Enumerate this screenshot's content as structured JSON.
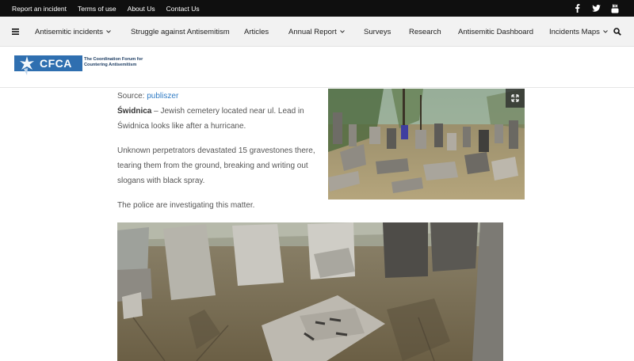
{
  "topbar": {
    "links": [
      "Report an incident",
      "Terms of use",
      "About Us",
      "Contact Us"
    ],
    "social_icons": [
      "facebook-icon",
      "twitter-icon",
      "youtube-icon"
    ]
  },
  "nav": {
    "items": [
      {
        "label": "Antisemitic incidents",
        "dropdown": true
      },
      {
        "label": "Struggle against Antisemitism",
        "dropdown": false
      },
      {
        "label": "Articles",
        "dropdown": false
      },
      {
        "label": "Annual Report",
        "dropdown": true
      },
      {
        "label": "Surveys",
        "dropdown": false
      },
      {
        "label": "Research",
        "dropdown": false
      },
      {
        "label": "Antisemitic Dashboard",
        "dropdown": false
      },
      {
        "label": "Incidents Maps",
        "dropdown": true
      }
    ]
  },
  "logo": {
    "name": "CFCA",
    "tagline_line1": "The Coordination Forum for",
    "tagline_line2": "Countering Antisemitism"
  },
  "article": {
    "source_label": "Source: ",
    "source_link": "publiszer",
    "p1_bold": "Świdnica",
    "p1_rest": " – Jewish cemetery located near ul. Lead in Świdnica looks like after a hurricane.",
    "p2": "Unknown perpetrators devastated 15 gravestones there, tearing them from the ground, breaking and writing out slogans with black spray.",
    "p3": "The police are investigating this matter."
  },
  "colors": {
    "topbar_bg": "#0f0f0f",
    "nav_bg": "#f2f2f2",
    "logo_blue": "#2f6fb0",
    "link_blue": "#2f7bc4"
  }
}
